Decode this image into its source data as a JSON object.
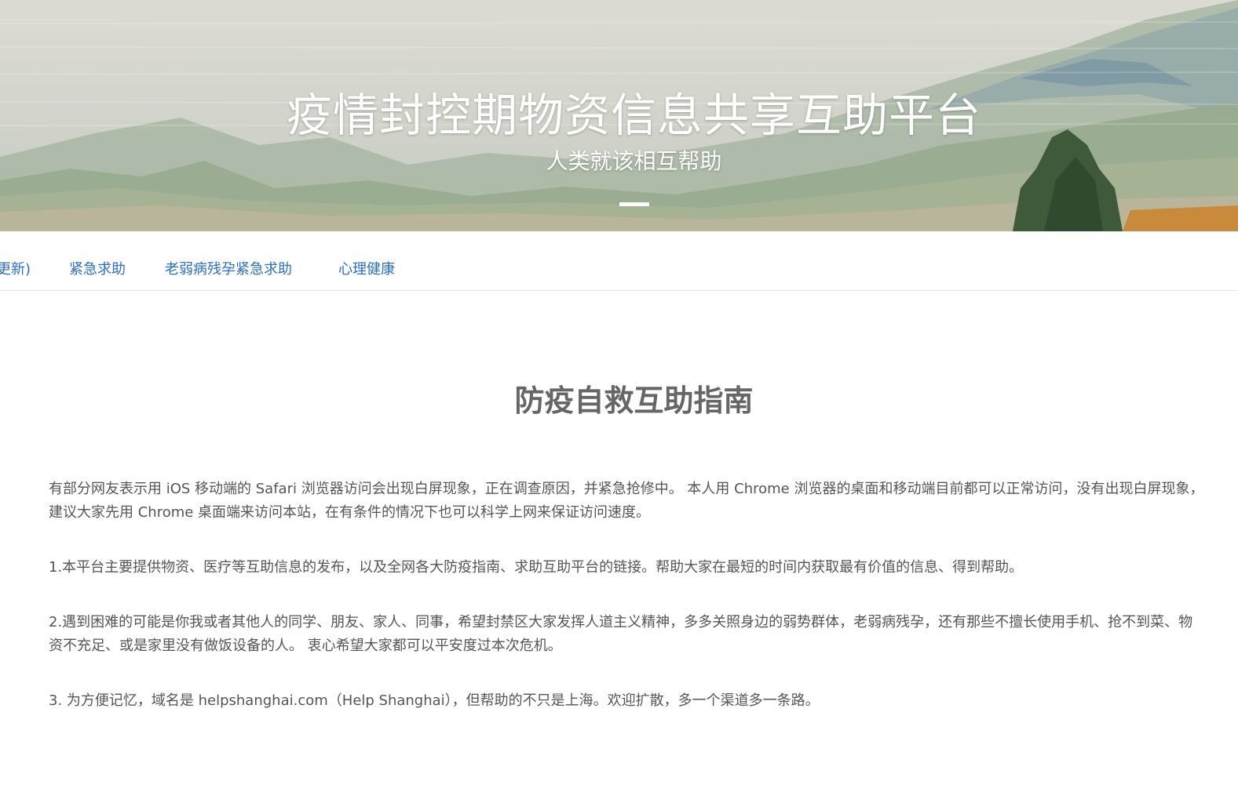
{
  "hero": {
    "title": "疫情封控期物资信息共享互助平台",
    "subtitle": "人类就该相互帮助"
  },
  "nav": {
    "items": [
      {
        "label": "更新)"
      },
      {
        "label": "紧急求助"
      },
      {
        "label": "老弱病残孕紧急求助"
      },
      {
        "label": "心理健康"
      }
    ]
  },
  "main": {
    "title": "防疫自救互助指南",
    "notice": "有部分网友表示用 iOS 移动端的 Safari 浏览器访问会出现白屏现象，正在调查原因，并紧急抢修中。 本人用 Chrome 浏览器的桌面和移动端目前都可以正常访问，没有出现白屏现象，建议大家先用 Chrome 桌面端来访问本站，在有条件的情况下也可以科学上网来保证访问速度。",
    "paragraphs": [
      "1.本平台主要提供物资、医疗等互助信息的发布，以及全网各大防疫指南、求助互助平台的链接。帮助大家在最短的时间内获取最有价值的信息、得到帮助。",
      "2.遇到困难的可能是你我或者其他人的同学、朋友、家人、同事，希望封禁区大家发挥人道主义精神，多多关照身边的弱势群体，老弱病残孕，还有那些不擅长使用手机、抢不到菜、物资不充足、或是家里没有做饭设备的人。 衷心希望大家都可以平安度过本次危机。",
      "3. 为方便记忆，域名是 helpshanghai.com（Help Shanghai），但帮助的不只是上海。欢迎扩散，多一个渠道多一条路。"
    ]
  },
  "colors": {
    "nav_link": "#2c6ec9",
    "body_text": "#555555",
    "title_text": "#666666"
  }
}
